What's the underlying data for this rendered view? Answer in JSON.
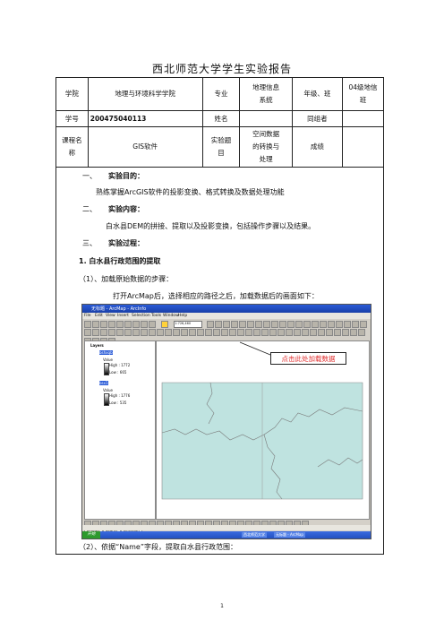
{
  "title": "西北师范大学学生实验报告",
  "table": {
    "r1": {
      "c1": "学院",
      "c2": "地理与环境科学学院",
      "c3": "专业",
      "c4a": "地理信息",
      "c4b": "系统",
      "c5": "年级、班",
      "c6a": "04级地信",
      "c6b": "班"
    },
    "r2": {
      "c1": "学号",
      "c2": "200475040113",
      "c3": "姓名",
      "c5": "同组者"
    },
    "r3": {
      "c1a": "课程名",
      "c1b": "称",
      "c2": "GIS软件",
      "c3a": "实验题",
      "c3b": "目",
      "c4a": "空间数据",
      "c4b": "的转换与",
      "c4c": "处理",
      "c5": "成绩"
    }
  },
  "sections": {
    "s1_num": "一、",
    "s1_title": "实验目的：",
    "s1_text": "熟练掌握ArcGIS软件的投影变换、格式转换及数据处理功能",
    "s2_num": "二、",
    "s2_title": "实验内容：",
    "s2_text": "白水县DEM的拼接、提取以及投影变换，包括操作步骤以及结果。",
    "s3_num": "三、",
    "s3_title": "实验过程：",
    "sub1": "1.  白水县行政范围的提取",
    "step1": "（1）、加载原始数据的步骤：",
    "step1_text": "打开ArcMap后，选择相应的路径之后，加载数据后的画面如下：",
    "step2": "（2）、依据“Name”字段，提取白水县行政范围："
  },
  "screenshot": {
    "window_title": "无标题 - ArcMap - ArcInfo",
    "menus": [
      "File",
      "Edit",
      "View",
      "Insert",
      "Selection",
      "Tools",
      "Window",
      "Help"
    ],
    "scale": "1:726,460",
    "toc_title": "Layers",
    "layers": [
      {
        "name": "bshxqb",
        "high": "High : 1772",
        "low": "Low : 665"
      },
      {
        "name": "bsx1",
        "high": "High : 1776",
        "low": "Low : 535"
      }
    ],
    "value_label": "Value",
    "toc_tabs": [
      "Display",
      "Source",
      "Selection"
    ],
    "callout": "点击此处加载数据",
    "start": "开始",
    "tasks": [
      "西北师范大学",
      "无标题 - ArcMap"
    ],
    "colors": {
      "map_fill": "#bfe3e0",
      "map_line": "#7a7a7a",
      "callout_text": "#e03030"
    }
  },
  "page_number": "1"
}
